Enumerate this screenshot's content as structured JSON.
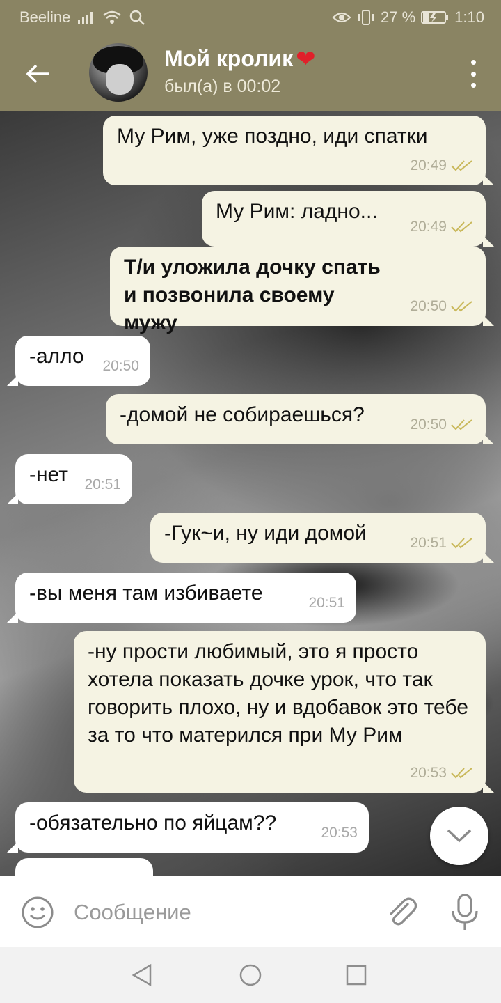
{
  "status_bar": {
    "carrier": "Beeline",
    "battery": "27 %",
    "time": "1:10"
  },
  "header": {
    "contact_name": "Мой кролик",
    "heart_emoji": "❤",
    "last_seen": "был(а) в 00:02"
  },
  "messages": [
    {
      "direction": "out",
      "text": "Му Рим, уже поздно, иди спатки",
      "time": "20:49",
      "read": true
    },
    {
      "direction": "out",
      "text": "Му Рим: ладно...",
      "time": "20:49",
      "read": true
    },
    {
      "direction": "out",
      "text": "Т/и уложила дочку спать и позвонила своему мужу",
      "time": "20:50",
      "read": true,
      "bold": true
    },
    {
      "direction": "in",
      "text": "-алло",
      "time": "20:50"
    },
    {
      "direction": "out",
      "text": "-домой не собираешься?",
      "time": "20:50",
      "read": true
    },
    {
      "direction": "in",
      "text": "-нет",
      "time": "20:51"
    },
    {
      "direction": "out",
      "text": "-Гук~и, ну иди домой",
      "time": "20:51",
      "read": true
    },
    {
      "direction": "in",
      "text": "-вы меня там избиваете",
      "time": "20:51"
    },
    {
      "direction": "out",
      "text": "-ну прости любимый, это я просто хотела показать дочке урок, что так говорить плохо, ну и вдобавок это тебе за то что матерился при Му Рим",
      "time": "20:53",
      "read": true
    },
    {
      "direction": "in",
      "text": "-обязательно по яйцам??",
      "time": "20:53"
    }
  ],
  "input": {
    "placeholder": "Сообщение",
    "value": ""
  },
  "colors": {
    "header_bg": "#8a8463",
    "outgoing_bubble": "#f5f3e3",
    "incoming_bubble": "#ffffff",
    "read_check": "#c9b85a"
  },
  "icons": {
    "back": "arrow-left-icon",
    "menu": "more-vertical-icon",
    "scroll_down": "chevron-down-icon",
    "emoji": "smile-icon",
    "attach": "paperclip-icon",
    "mic": "microphone-icon",
    "nav_back": "triangle-back-icon",
    "nav_home": "circle-home-icon",
    "nav_recent": "square-recent-icon"
  }
}
